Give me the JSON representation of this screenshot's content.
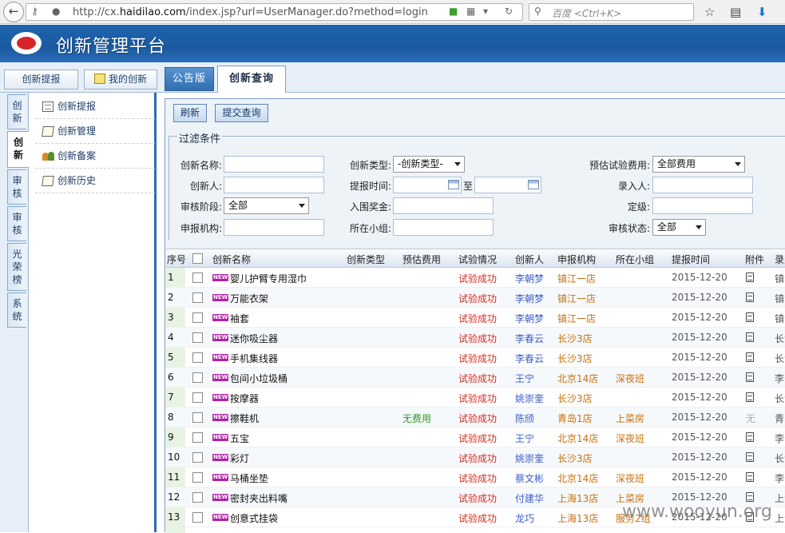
{
  "browser": {
    "url_prefix": "http://cx.",
    "url_domain": "haidilao.com",
    "url_path": "/index.jsp?url=UserManager.do?method=login",
    "search_placeholder": "百度 <Ctrl+K>"
  },
  "app": {
    "title": "创新管理平台"
  },
  "topnav": {
    "btn_propose": "创新提报",
    "btn_mine": "我的创新",
    "tab_notice": "公告版",
    "tab_query": "创新查询"
  },
  "vtabs": [
    "创新",
    "创新",
    "审核",
    "审核",
    "光荣榜",
    "系统"
  ],
  "menu": [
    "创新提报",
    "创新管理",
    "创新备案",
    "创新历史"
  ],
  "actions": {
    "refresh": "刷新",
    "submit_query": "提交查询"
  },
  "filter": {
    "legend": "过滤条件",
    "name_label": "创新名称:",
    "creator_label": "创新人:",
    "stage_label": "审核阶段:",
    "org_label": "申报机构:",
    "type_label": "创新类型:",
    "type_value": "-创新类型-",
    "time_label": "提报时间:",
    "to_label": "至",
    "prize_label": "入围奖金:",
    "group_label": "所在小组:",
    "fee_label": "预估试验费用:",
    "fee_value": "全部费用",
    "entry_label": "录入人:",
    "grade_label": "定级:",
    "status_label": "审核状态:",
    "stage_value": "全部",
    "status_value": "全部"
  },
  "table": {
    "headers": [
      "序号",
      "创新名称",
      "创新类型",
      "预估费用",
      "试验情况",
      "创新人",
      "申报机构",
      "所在小组",
      "提报时间",
      "附件",
      "录入"
    ],
    "new_badge": "NEW",
    "rows": [
      {
        "no": "1",
        "name": "婴儿护臂专用湿巾",
        "fee": "",
        "result": "试验成功",
        "person": "李朝梦",
        "org": "镇江一店",
        "group": "",
        "date": "2015-12-20",
        "att": "icon",
        "cut": "镇江"
      },
      {
        "no": "2",
        "name": "万能衣架",
        "fee": "",
        "result": "试验成功",
        "person": "李朝梦",
        "org": "镇江一店",
        "group": "",
        "date": "2015-12-20",
        "att": "icon",
        "cut": "镇江"
      },
      {
        "no": "3",
        "name": "袖套",
        "fee": "",
        "result": "试验成功",
        "person": "李朝梦",
        "org": "镇江一店",
        "group": "",
        "date": "2015-12-20",
        "att": "icon",
        "cut": "镇江"
      },
      {
        "no": "4",
        "name": "迷你吸尘器",
        "fee": "",
        "result": "试验成功",
        "person": "李春云",
        "org": "长沙3店",
        "group": "",
        "date": "2015-12-20",
        "att": "icon",
        "cut": "长沙"
      },
      {
        "no": "5",
        "name": "手机集线器",
        "fee": "",
        "result": "试验成功",
        "person": "李春云",
        "org": "长沙3店",
        "group": "",
        "date": "2015-12-20",
        "att": "icon",
        "cut": "长沙"
      },
      {
        "no": "6",
        "name": "包间小垃圾桶",
        "fee": "",
        "result": "试验成功",
        "person": "王宁",
        "org": "北京14店",
        "group": "深夜班",
        "date": "2015-12-20",
        "att": "icon",
        "cut": "李宁"
      },
      {
        "no": "7",
        "name": "按摩器",
        "fee": "",
        "result": "试验成功",
        "person": "姚崇奎",
        "org": "长沙3店",
        "group": "",
        "date": "2015-12-20",
        "att": "icon",
        "cut": "长沙"
      },
      {
        "no": "8",
        "name": "擦鞋机",
        "fee": "无费用",
        "result": "试验成功",
        "person": "陈颀",
        "org": "青岛1店",
        "group": "上菜房",
        "date": "2015-12-20",
        "att": "无",
        "cut": "青岛"
      },
      {
        "no": "9",
        "name": "五宝",
        "fee": "",
        "result": "试验成功",
        "person": "王宁",
        "org": "北京14店",
        "group": "深夜班",
        "date": "2015-12-20",
        "att": "icon",
        "cut": "李宁"
      },
      {
        "no": "10",
        "name": "彩灯",
        "fee": "",
        "result": "试验成功",
        "person": "姚崇奎",
        "org": "长沙3店",
        "group": "",
        "date": "2015-12-20",
        "att": "icon",
        "cut": "长沙"
      },
      {
        "no": "11",
        "name": "马桶坐垫",
        "fee": "",
        "result": "试验成功",
        "person": "蔡文彬",
        "org": "北京14店",
        "group": "深夜班",
        "date": "2015-12-20",
        "att": "icon",
        "cut": "李宁"
      },
      {
        "no": "12",
        "name": "密封夹出料嘴",
        "fee": "",
        "result": "试验成功",
        "person": "付建华",
        "org": "上海13店",
        "group": "上菜房",
        "date": "2015-12-20",
        "att": "icon",
        "cut": "上海"
      },
      {
        "no": "13",
        "name": "创意式挂袋",
        "fee": "",
        "result": "试验成功",
        "person": "龙巧",
        "org": "上海13店",
        "group": "服务2组",
        "date": "2015-12-20",
        "att": "icon",
        "cut": "上海"
      }
    ]
  },
  "watermark": "www.wooyun.org"
}
